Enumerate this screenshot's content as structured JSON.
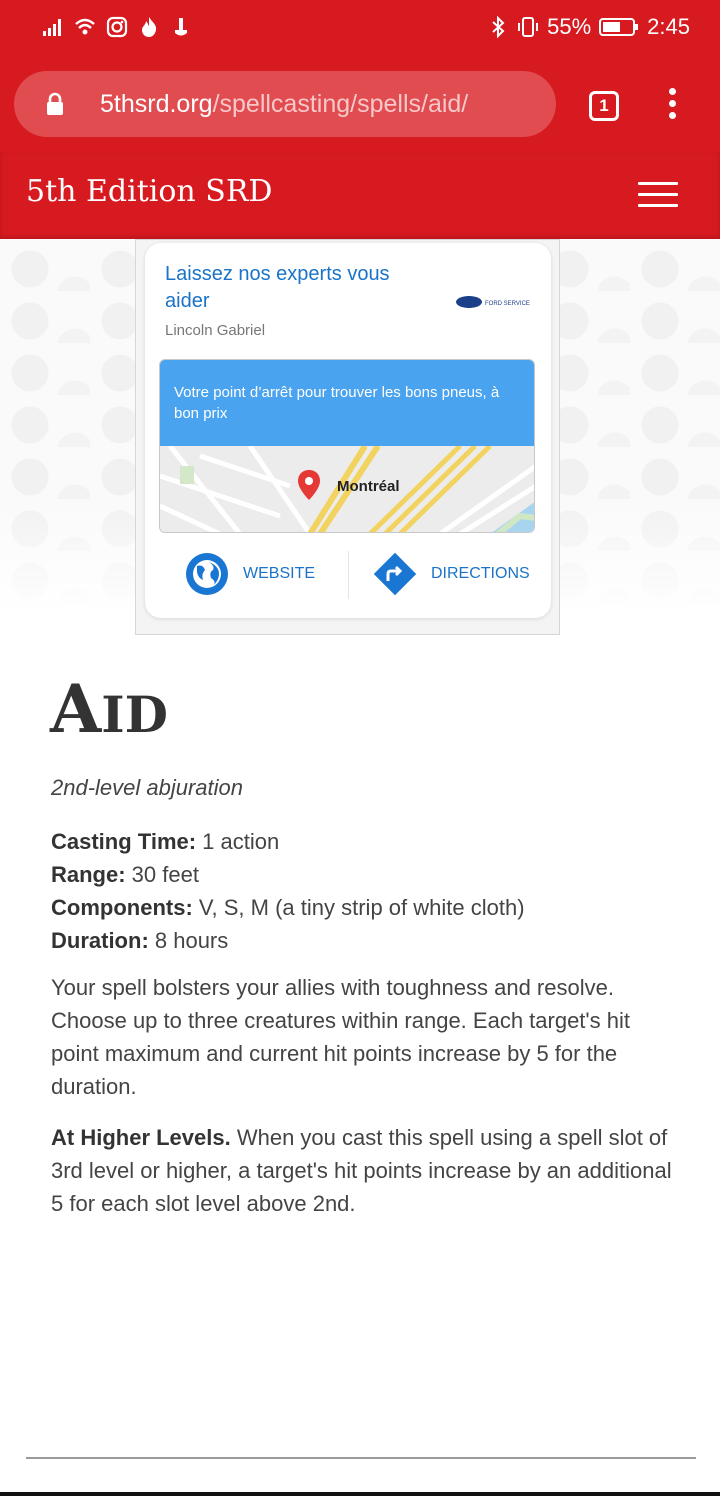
{
  "status_bar": {
    "battery": "55%",
    "time": "2:45",
    "icons": [
      "signal-icon",
      "wifi-icon",
      "instagram-icon",
      "fire-icon",
      "usb-icon",
      "bluetooth-icon",
      "vibrate-icon",
      "battery-icon"
    ]
  },
  "browser": {
    "url_domain": "5thsrd.org",
    "url_path": "/spellcasting/spells/aid/",
    "tab_count": "1"
  },
  "site": {
    "title": "5th Edition SRD"
  },
  "ad": {
    "headline": "Laissez nos experts vous aider",
    "advertiser": "Lincoln Gabriel",
    "banner_text": "Votre point d’arrêt pour trouver les bons pneus, à bon prix",
    "city": "Montréal",
    "website_label": "WEBSITE",
    "directions_label": "DIRECTIONS",
    "brand_text": "FORD SERVICE"
  },
  "spell": {
    "title_first": "A",
    "title_rest": "ID",
    "school": "2nd-level abjuration",
    "casting_time_label": "Casting Time:",
    "casting_time": " 1 action",
    "range_label": "Range:",
    "range": " 30 feet",
    "components_label": "Components:",
    "components": " V, S, M (a tiny strip of white cloth)",
    "duration_label": "Duration:",
    "duration": " 8 hours",
    "description": "Your spell bolsters your allies with toughness and resolve. Choose up to three creatures within range. Each target's hit point maximum and current hit points increase by 5 for the duration.",
    "higher_label": "At Higher Levels.",
    "higher_text": " When you cast this spell using a spell slot of 3rd level or higher, a target's hit points increase by an additional 5 for each slot level above 2nd."
  },
  "colors": {
    "brand_red": "#d71920",
    "link_blue": "#1a73c8",
    "banner_blue": "#4aa3ee"
  }
}
